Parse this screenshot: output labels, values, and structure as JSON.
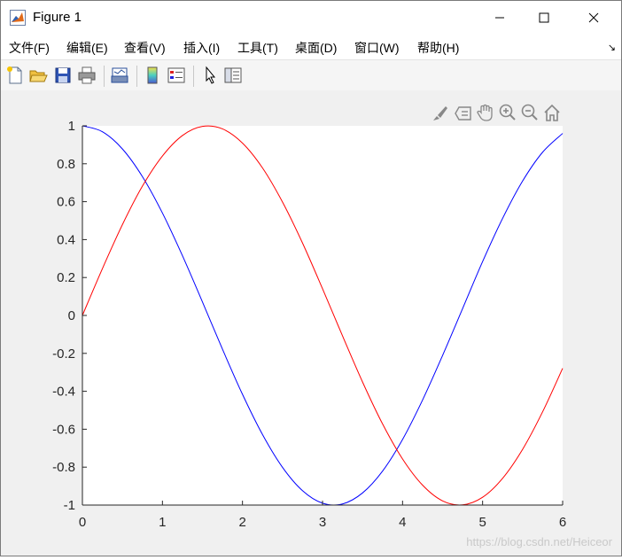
{
  "window": {
    "title": "Figure 1",
    "controls": {
      "minimize": "—",
      "maximize": "☐",
      "close": "✕"
    }
  },
  "menu": {
    "items": [
      "文件(F)",
      "编辑(E)",
      "查看(V)",
      "插入(I)",
      "工具(T)",
      "桌面(D)",
      "窗口(W)",
      "帮助(H)"
    ],
    "overflow_arrow": "↘"
  },
  "toolbar": {
    "icons": [
      "new-figure-icon",
      "open-file-icon",
      "save-icon",
      "print-icon",
      "link-plot-icon",
      "colorbar-icon",
      "legend-icon",
      "pointer-icon",
      "property-editor-icon"
    ]
  },
  "axes_toolbar": {
    "icons": [
      "brush-icon",
      "data-tips-icon",
      "pan-icon",
      "zoom-in-icon",
      "zoom-out-icon",
      "home-icon"
    ]
  },
  "chart_data": {
    "type": "line",
    "title": "",
    "xlabel": "",
    "ylabel": "",
    "xlim": [
      0,
      6
    ],
    "ylim": [
      -1,
      1
    ],
    "xticks": [
      "0",
      "1",
      "2",
      "3",
      "4",
      "5",
      "6"
    ],
    "yticks": [
      "1",
      "0.8",
      "0.6",
      "0.4",
      "0.2",
      "0",
      "-0.2",
      "-0.4",
      "-0.6",
      "-0.8",
      "-1"
    ],
    "grid": false,
    "series": [
      {
        "color": "#0000ff",
        "x": [
          0,
          0.25,
          0.5,
          0.75,
          1,
          1.25,
          1.5,
          1.75,
          2,
          2.25,
          2.5,
          2.75,
          3,
          3.25,
          3.5,
          3.75,
          4,
          4.25,
          4.5,
          4.75,
          5,
          5.25,
          5.5,
          5.75,
          6
        ],
        "values": [
          1,
          0.969,
          0.878,
          0.732,
          0.54,
          0.315,
          0.071,
          -0.178,
          -0.416,
          -0.628,
          -0.801,
          -0.924,
          -0.99,
          -0.994,
          -0.936,
          -0.821,
          -0.654,
          -0.446,
          -0.211,
          0.036,
          0.284,
          0.512,
          0.709,
          0.861,
          0.96
        ]
      },
      {
        "color": "#ff0000",
        "x": [
          0,
          0.25,
          0.5,
          0.75,
          1,
          1.25,
          1.5,
          1.75,
          2,
          2.25,
          2.5,
          2.75,
          3,
          3.25,
          3.5,
          3.75,
          4,
          4.25,
          4.5,
          4.75,
          5,
          5.25,
          5.5,
          5.75,
          6
        ],
        "values": [
          0,
          0.247,
          0.479,
          0.682,
          0.841,
          0.949,
          0.997,
          0.984,
          0.909,
          0.778,
          0.598,
          0.382,
          0.141,
          -0.108,
          -0.351,
          -0.572,
          -0.757,
          -0.895,
          -0.978,
          -0.999,
          -0.959,
          -0.859,
          -0.706,
          -0.508,
          -0.279
        ]
      }
    ]
  },
  "watermark": "https://blog.csdn.net/Heiceor"
}
